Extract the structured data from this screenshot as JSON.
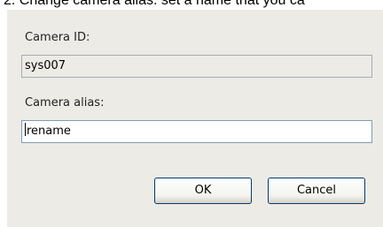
{
  "caption": {
    "text": "2. Change camera alias: set a name that you ca"
  },
  "dialog": {
    "camera_id_label": "Camera ID:",
    "camera_id_value": "sys007",
    "camera_alias_label": "Camera alias:",
    "camera_alias_value": "rename",
    "ok_label": "OK",
    "cancel_label": "Cancel"
  },
  "colors": {
    "dialog_background": "#ecebe6",
    "field_border": "#a5acb2",
    "button_border": "#003c74"
  }
}
